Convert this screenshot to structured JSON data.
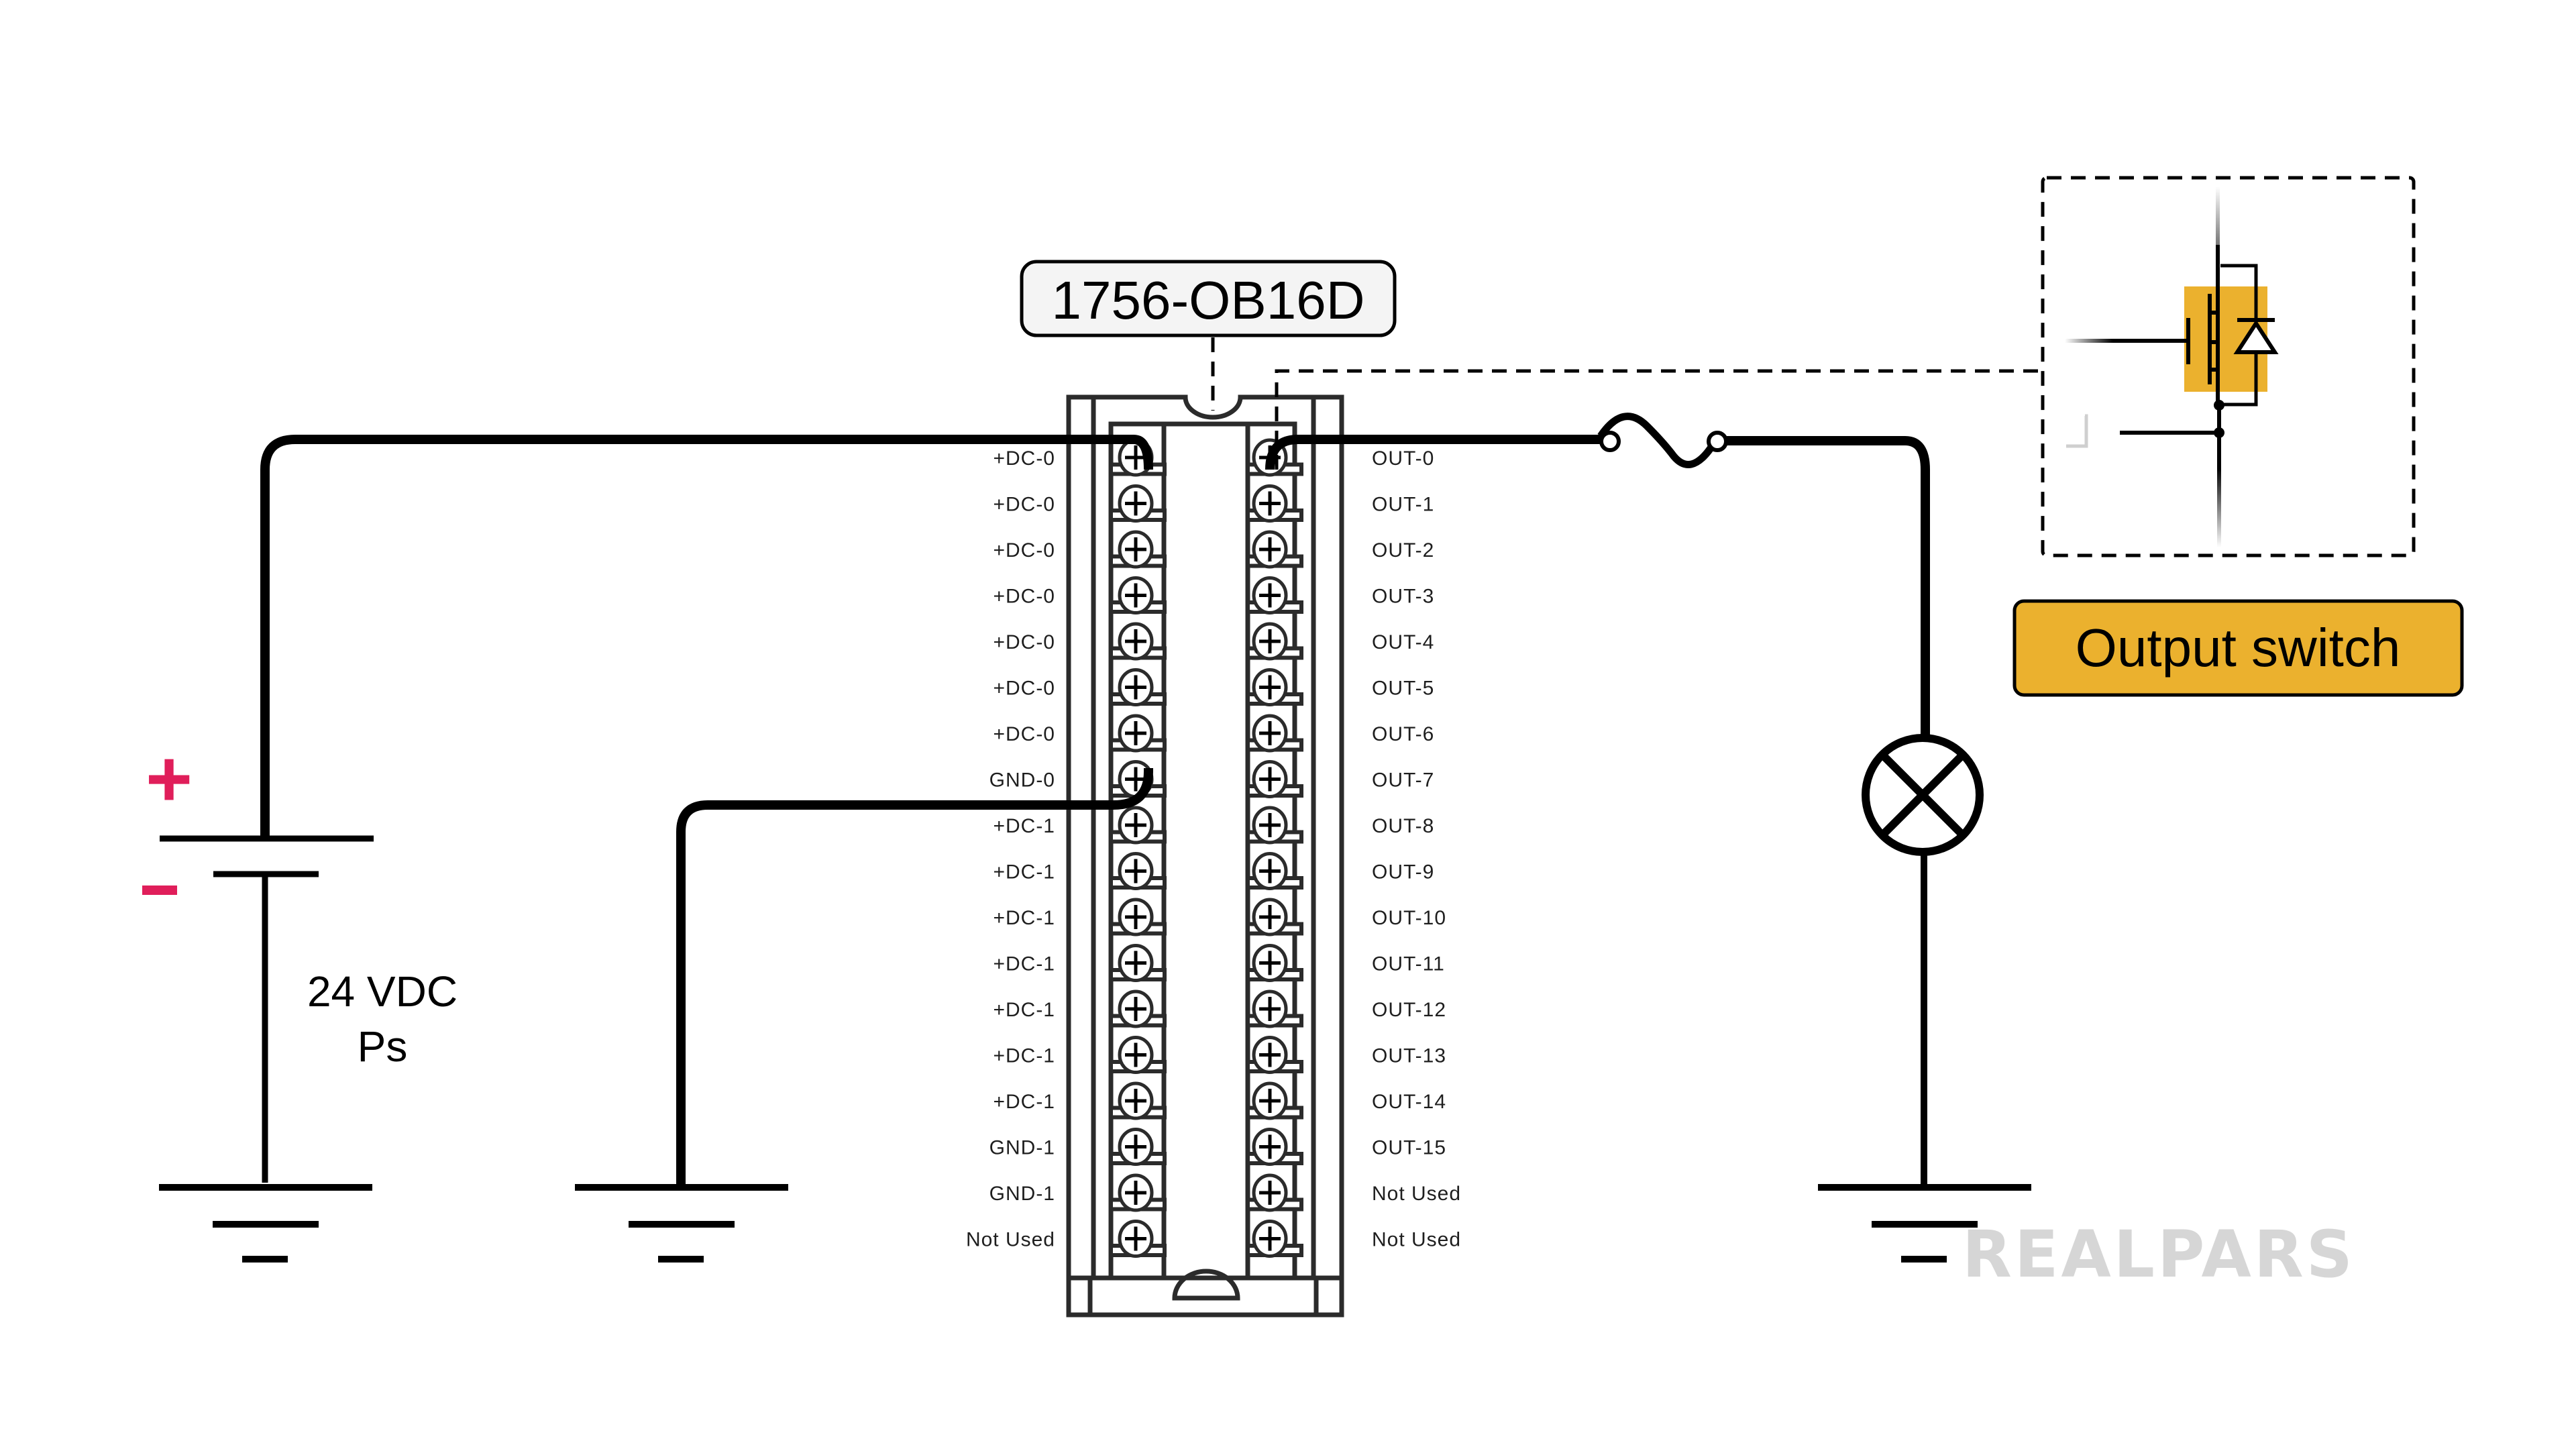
{
  "module": {
    "model": "1756-OB16D",
    "left_terminals": [
      "+DC-0",
      "+DC-0",
      "+DC-0",
      "+DC-0",
      "+DC-0",
      "+DC-0",
      "+DC-0",
      "GND-0",
      "+DC-1",
      "+DC-1",
      "+DC-1",
      "+DC-1",
      "+DC-1",
      "+DC-1",
      "+DC-1",
      "GND-1",
      "GND-1",
      "Not Used"
    ],
    "right_terminals": [
      "OUT-0",
      "OUT-1",
      "OUT-2",
      "OUT-3",
      "OUT-4",
      "OUT-5",
      "OUT-6",
      "OUT-7",
      "OUT-8",
      "OUT-9",
      "OUT-10",
      "OUT-11",
      "OUT-12",
      "OUT-13",
      "OUT-14",
      "OUT-15",
      "Not Used",
      "Not Used"
    ]
  },
  "power_supply": {
    "plus_sign": "+",
    "minus_sign": "−",
    "label_line1": "24 VDC",
    "label_line2": "Ps"
  },
  "output_switch": {
    "label": "Output switch"
  },
  "components": {
    "fuse": "fuse-icon",
    "lamp": "lamp-icon",
    "grounds": [
      "ground-icon",
      "ground-icon",
      "ground-icon"
    ],
    "mosfet": "mosfet-icon",
    "diode": "diode-icon"
  },
  "brand": {
    "logo_text": "REALPARS"
  },
  "colors": {
    "accent": "#EBB12E",
    "polarity": "#E01E5A",
    "label_box_bg": "#F4F4F4",
    "logo": "#D6D6D6"
  }
}
